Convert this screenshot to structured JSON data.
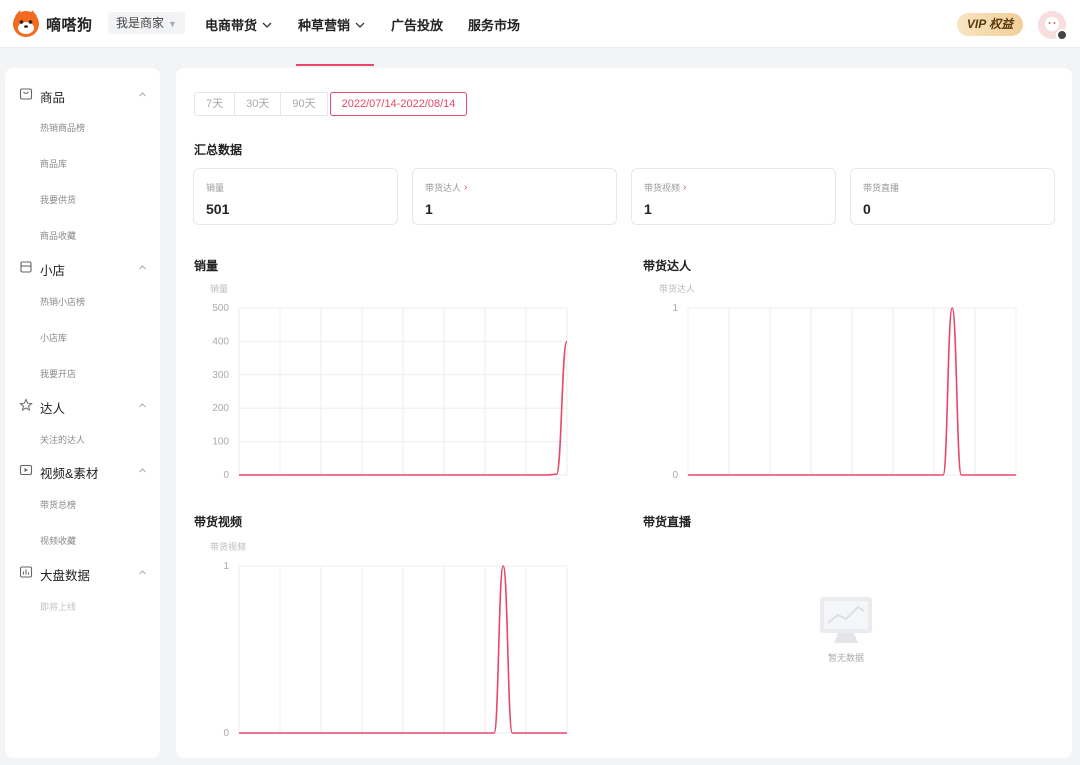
{
  "header": {
    "brand": "嘀嗒狗",
    "role_selector": "我是商家",
    "nav": [
      {
        "label": "电商带货",
        "has_dropdown": true
      },
      {
        "label": "种草营销",
        "has_dropdown": true
      },
      {
        "label": "广告投放",
        "has_dropdown": false
      },
      {
        "label": "服务市场",
        "has_dropdown": false
      }
    ],
    "vip_label": "VIP 权益"
  },
  "sidebar": {
    "groups": [
      {
        "label": "商品",
        "icon": "bag-icon",
        "items": [
          "热销商品榜",
          "商品库",
          "我要供货",
          "商品收藏"
        ]
      },
      {
        "label": "小店",
        "icon": "store-icon",
        "items": [
          "热销小店榜",
          "小店库",
          "我要开店"
        ]
      },
      {
        "label": "达人",
        "icon": "star-icon",
        "items": [
          "关注的达人"
        ]
      },
      {
        "label": "视频&素材",
        "icon": "video-icon",
        "items": [
          "带货总榜",
          "视频收藏"
        ]
      },
      {
        "label": "大盘数据",
        "icon": "dashboard-icon",
        "items": [
          "即将上线"
        ]
      }
    ]
  },
  "date_ranges": [
    "7天",
    "30天",
    "90天",
    "2022/07/14-2022/08/14"
  ],
  "selected_range": "2022/07/14-2022/08/14",
  "summary": {
    "title": "汇总数据",
    "cards": [
      {
        "label": "销量",
        "value": "501",
        "link": false
      },
      {
        "label": "带货达人",
        "value": "1",
        "link": true
      },
      {
        "label": "带货视频",
        "value": "1",
        "link": true
      },
      {
        "label": "带货直播",
        "value": "0",
        "link": false
      }
    ]
  },
  "charts_titles": {
    "sales": "销量",
    "talents": "带货达人",
    "videos": "带货视频",
    "live": "带货直播"
  },
  "empty_state": "暂无数据",
  "accent_color": "#e8466a",
  "chart_data": [
    {
      "type": "line",
      "title": "销量",
      "ylabel": "销量",
      "ylim": [
        0,
        500
      ],
      "yticks": [
        "0",
        "100",
        "200",
        "300",
        "400",
        "500"
      ],
      "series": [
        {
          "values": [
            0,
            0,
            0,
            0,
            0,
            0,
            0,
            0,
            0,
            0,
            0,
            0,
            0,
            0,
            0,
            0,
            0,
            0,
            0,
            0,
            0,
            0,
            0,
            0,
            0,
            0,
            0,
            0,
            0,
            0,
            2,
            400
          ]
        }
      ],
      "grid": true
    },
    {
      "type": "line",
      "title": "带货达人",
      "ylabel": "带货达人",
      "ylim": [
        0,
        1
      ],
      "yticks": [
        "0",
        "1"
      ],
      "series": [
        {
          "values": [
            0,
            0,
            0,
            0,
            0,
            0,
            0,
            0,
            0,
            0,
            0,
            0,
            0,
            0,
            0,
            0,
            0,
            0,
            0,
            0,
            0,
            0,
            0,
            0,
            0,
            0,
            0,
            0,
            0,
            1,
            0,
            0,
            0,
            0,
            0,
            0,
            0
          ]
        }
      ],
      "grid": true
    },
    {
      "type": "line",
      "title": "带货视频",
      "ylabel": "带货视频",
      "ylim": [
        0,
        1
      ],
      "yticks": [
        "0",
        "1"
      ],
      "series": [
        {
          "values": [
            0,
            0,
            0,
            0,
            0,
            0,
            0,
            0,
            0,
            0,
            0,
            0,
            0,
            0,
            0,
            0,
            0,
            0,
            0,
            0,
            0,
            0,
            0,
            0,
            0,
            0,
            0,
            0,
            0,
            1,
            0,
            0,
            0,
            0,
            0,
            0,
            0
          ]
        }
      ],
      "grid": true
    }
  ]
}
